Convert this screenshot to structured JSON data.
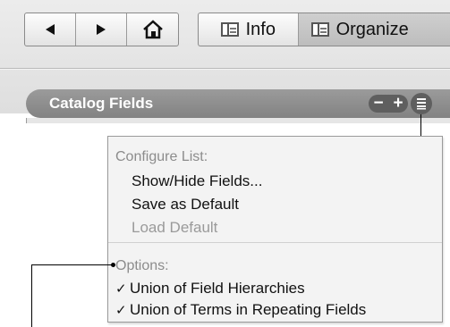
{
  "toolbar": {
    "nav": {
      "back_icon": "left-triangle-icon",
      "forward_icon": "right-triangle-icon",
      "home_icon": "home-icon"
    },
    "info_label": "Info",
    "organize_label": "Organize"
  },
  "pane": {
    "title": "Catalog Fields",
    "remove_label": "−",
    "add_label": "+",
    "menu_icon": "list-menu-icon"
  },
  "menu": {
    "configure_header": "Configure List:",
    "show_hide": "Show/Hide Fields...",
    "save_default": "Save as Default",
    "load_default": "Load Default",
    "options_header": "Options:",
    "check_mark": "✓",
    "union_hierarchies": "Union of Field Hierarchies",
    "union_terms": "Union of Terms in Repeating Fields"
  }
}
